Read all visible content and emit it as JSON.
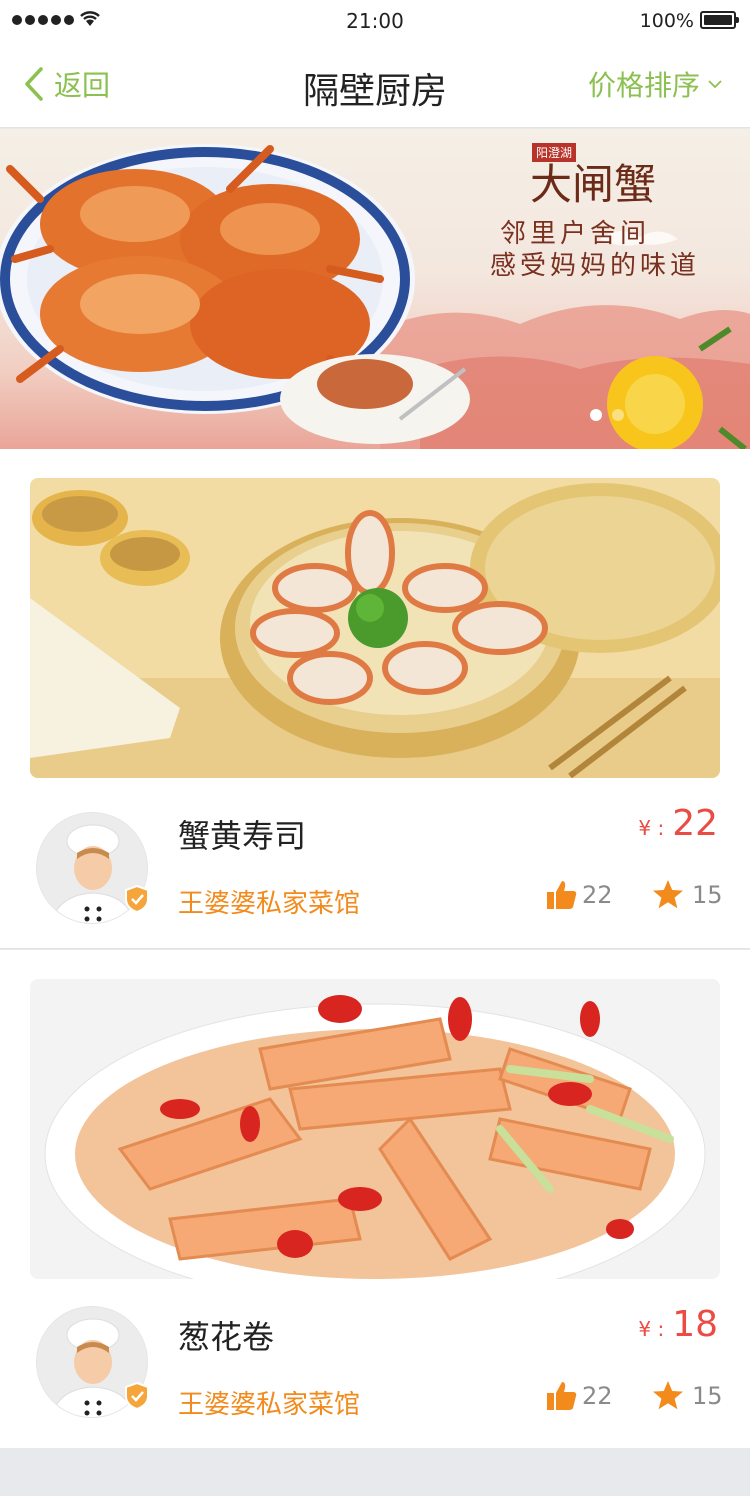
{
  "status_bar": {
    "time": "21:00",
    "battery": "100%"
  },
  "nav": {
    "back_label": "返回",
    "title": "隔壁厨房",
    "sort_label": "价格排序"
  },
  "banner": {
    "brand_tag": "阳澄湖",
    "brand_name": "大闸蟹",
    "line1": "邻里户舍间",
    "line2": "感受妈妈的味道",
    "dots": 2,
    "active_dot": 0
  },
  "dishes": [
    {
      "name": "蟹黄寿司",
      "shop": "王婆婆私家菜馆",
      "currency": "¥ :",
      "price": "22",
      "likes": "22",
      "favorites": "15"
    },
    {
      "name": "葱花卷",
      "shop": "王婆婆私家菜馆",
      "currency": "¥ :",
      "price": "18",
      "likes": "22",
      "favorites": "15"
    }
  ],
  "colors": {
    "accent_green": "#8cc152",
    "shop_orange": "#f28a1c",
    "price_red": "#ea4b43"
  }
}
